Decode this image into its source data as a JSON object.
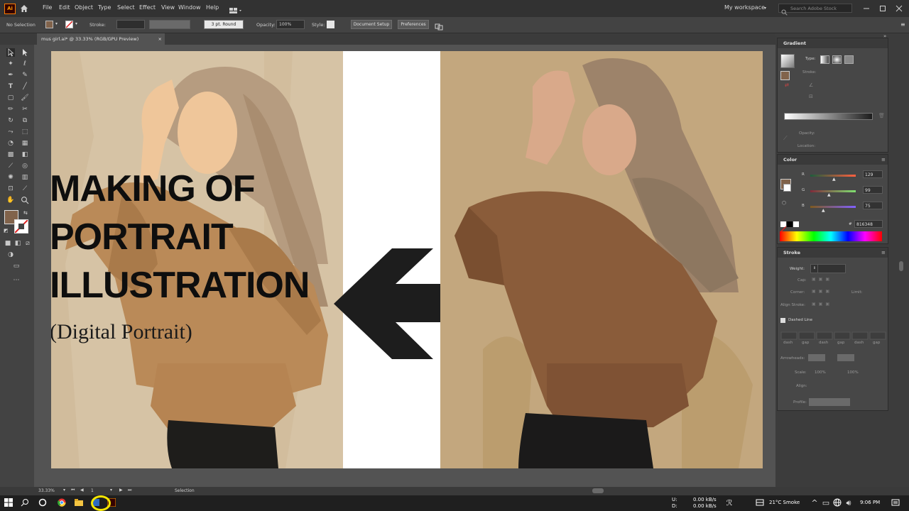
{
  "menubar": {
    "logo": "Ai",
    "menus": [
      "File",
      "Edit",
      "Object",
      "Type",
      "Select",
      "Effect",
      "View",
      "Window",
      "Help"
    ],
    "workspace": "My workspace",
    "search_placeholder": "Search Adobe Stock"
  },
  "controlbar": {
    "selection_state": "No Selection",
    "stroke_label": "Stroke:",
    "brush": "3 pt. Round",
    "opacity_label": "Opacity:",
    "opacity_value": "100%",
    "style_label": "Style:",
    "document_setup": "Document Setup",
    "preferences": "Preferences"
  },
  "document": {
    "tab_title": "mus girl.ai* @ 33.33% (RGB/GPU Preview)",
    "close": "×"
  },
  "artwork": {
    "line1": "MAKING OF",
    "line2": "PORTRAIT",
    "line3": "ILLUSTRATION",
    "subtitle": "(Digital Portrait)"
  },
  "gradient_panel": {
    "title": "Gradient",
    "type_label": "Type:",
    "stroke_label": "Stroke:",
    "opacity_label": "Opacity:",
    "location_label": "Location:"
  },
  "color_panel": {
    "title": "Color",
    "r_label": "R",
    "g_label": "G",
    "b_label": "B",
    "r": "129",
    "g": "99",
    "b": "75",
    "hex_label": "#",
    "hex": "816348",
    "fill_color": "#81634b"
  },
  "stroke_panel": {
    "title": "Stroke",
    "weight_label": "Weight:",
    "cap_label": "Cap:",
    "corner_label": "Corner:",
    "limit_label": "Limit:",
    "align_label": "Align Stroke:",
    "dashed_line": "Dashed Line",
    "dash_labels": [
      "dash",
      "gap",
      "dash",
      "gap",
      "dash",
      "gap"
    ],
    "arrowheads_label": "Arrowheads:",
    "scale_label": "Scale:",
    "scale1": "100%",
    "scale2": "100%",
    "align2_label": "Align:",
    "profile_label": "Profile:"
  },
  "statusbar": {
    "zoom": "33.33%",
    "artboard": "1",
    "tool": "Selection"
  },
  "taskbar": {
    "net_up_label": "U:",
    "net_down_label": "D:",
    "net_up": "0.00 kB/s",
    "net_down": "0.00 kB/s",
    "weather": "21°C Smoke",
    "time": "9:06 PM"
  }
}
